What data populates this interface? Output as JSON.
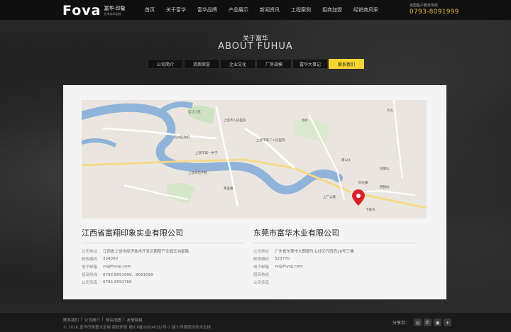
{
  "header": {
    "logo_text": "Fova",
    "logo_sub_cn": "富华·印象",
    "logo_sub_tag": "艺术实木定制",
    "nav": [
      "首页",
      "关于富华",
      "富华品牌",
      "产品展示",
      "新闻资讯",
      "工程案例",
      "招商加盟",
      "经销商风采"
    ],
    "hotline_label": "全国客户服务热线",
    "hotline_number": "0793-8091999"
  },
  "banner": {
    "title_cn": "关于富华",
    "title_en": "ABOUT FUHUA"
  },
  "tabs": [
    {
      "label": "公司简介",
      "active": false
    },
    {
      "label": "资质荣誉",
      "active": false
    },
    {
      "label": "企业文化",
      "active": false
    },
    {
      "label": "厂房规模",
      "active": false
    },
    {
      "label": "富华大事记",
      "active": false
    },
    {
      "label": "联系我们",
      "active": true
    }
  ],
  "map": {
    "labels": [
      "信江小区",
      "上饶市人民医院",
      "信州区政府",
      "上饶市第二人民医院",
      "上饶市第一中学",
      "上饶师范学院",
      "上广公路",
      "下排坞",
      "仰天螺",
      "南山头",
      "凤凰山",
      "野猪坑",
      "茶圣路",
      "大山",
      "北岭"
    ]
  },
  "companies": [
    {
      "name": "江西省富翔印象实业有限公司",
      "rows": [
        {
          "k": "公司地址",
          "v": "江西省上饶市经济技术开发区朝阳产业园五洲星路"
        },
        {
          "k": "邮政编码",
          "v": "334000"
        },
        {
          "k": "电子邮箱",
          "v": "zs@fhyxjj.com"
        },
        {
          "k": "招商热线",
          "v": "0793-8091999、8091599"
        },
        {
          "k": "公司传真",
          "v": "0793-8091766"
        }
      ]
    },
    {
      "name": "东莞市富华木业有限公司",
      "rows": [
        {
          "k": "公司地址",
          "v": "广东省东莞市大朗镇竹山社区行西西28号三楼"
        },
        {
          "k": "邮政编码",
          "v": "523770"
        },
        {
          "k": "电子邮箱",
          "v": "zs@fhyxjj.com"
        },
        {
          "k": "招商热线",
          "v": ""
        },
        {
          "k": "公司传真",
          "v": ""
        }
      ]
    }
  ],
  "footer": {
    "links": [
      "联系我们",
      "|",
      "公司简介",
      "|",
      "网站地图",
      "|",
      "友情链接"
    ],
    "copyright": "© 2016 富华印象整木定制 版权所有 赣ICP备16004332号-1 骏人传媒提供技术支持",
    "share_label": "分享到：",
    "share_icons": [
      "weibo",
      "wechat",
      "qq",
      "more"
    ]
  },
  "colors": {
    "accent_yellow": "#f6d533",
    "hotline_gold": "#e6b93c",
    "brand_red": "#e6232a",
    "map_marker": "#d9232b"
  }
}
